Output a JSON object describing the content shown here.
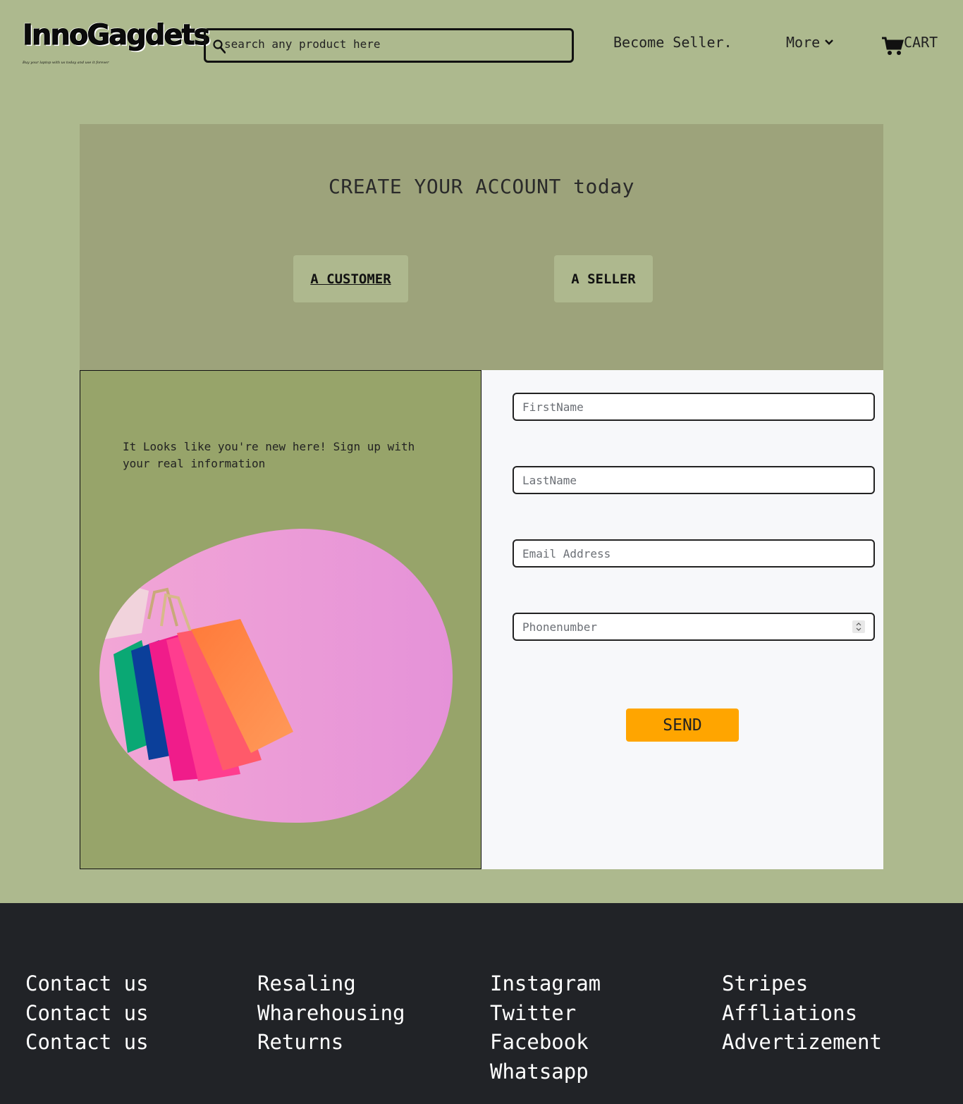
{
  "header": {
    "logo_text": "InnoGagdets",
    "tagline": "Buy your laptop with us today and use it forever",
    "search_placeholder": "search any product here",
    "become_seller": "Become Seller.",
    "more": "More",
    "cart": "CART"
  },
  "hero": {
    "title": "CREATE YOUR ACCOUNT today",
    "customer_button": "A CUSTOMER",
    "seller_button": "A SELLER"
  },
  "left_panel": {
    "intro": "It Looks like you're new here! Sign up with your real information"
  },
  "form": {
    "first_name_placeholder": "FirstName",
    "last_name_placeholder": "LastName",
    "email_placeholder": "Email Address",
    "phone_placeholder": "Phonenumber",
    "send_label": "SEND"
  },
  "footer": {
    "col1": [
      "Contact us",
      "Contact us",
      "Contact us"
    ],
    "col2": [
      "Resaling",
      "Wharehousing",
      "Returns"
    ],
    "col3": [
      "Instagram",
      "Twitter",
      "Facebook",
      "Whatsapp"
    ],
    "col4": [
      "Stripes",
      "Affliations",
      "Advertizement"
    ]
  },
  "colors": {
    "page_bg": "#adb98e",
    "hero_bg": "#9da37b",
    "panel_bg": "#97a46a",
    "send_button": "#ffa500",
    "footer_bg": "#212327"
  },
  "icons": [
    "search-icon",
    "chevron-down-icon",
    "cart-icon",
    "shopping-bags-image"
  ]
}
